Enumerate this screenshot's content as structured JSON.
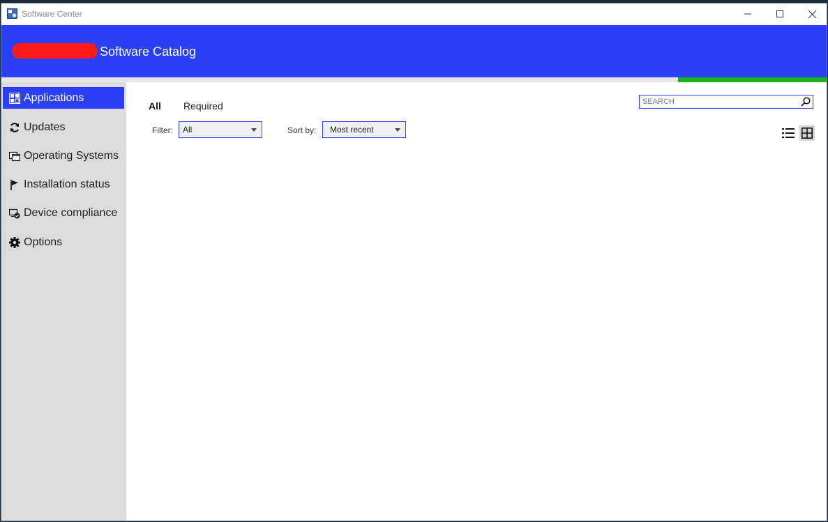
{
  "window": {
    "title": "Software Center"
  },
  "header": {
    "title": "Software Catalog"
  },
  "progress": {
    "value": 0.18
  },
  "sidebar": {
    "items": [
      {
        "label": "Applications",
        "icon": "applications-icon",
        "active": true
      },
      {
        "label": "Updates",
        "icon": "refresh-icon",
        "active": false
      },
      {
        "label": "Operating Systems",
        "icon": "windows-stack-icon",
        "active": false
      },
      {
        "label": "Installation status",
        "icon": "flag-icon",
        "active": false
      },
      {
        "label": "Device compliance",
        "icon": "device-check-icon",
        "active": false
      },
      {
        "label": "Options",
        "icon": "gear-icon",
        "active": false
      }
    ]
  },
  "main": {
    "tabs": [
      {
        "label": "All",
        "active": true
      },
      {
        "label": "Required",
        "active": false
      }
    ],
    "filter": {
      "label": "Filter:",
      "value": "All"
    },
    "sort": {
      "label": "Sort by:",
      "value": "Most recent"
    },
    "search": {
      "placeholder": "SEARCH"
    },
    "view_mode": "tiles"
  },
  "colors": {
    "accent": "#2b40f5",
    "progress": "#1db31d",
    "sidebar": "#dcdcdc"
  }
}
